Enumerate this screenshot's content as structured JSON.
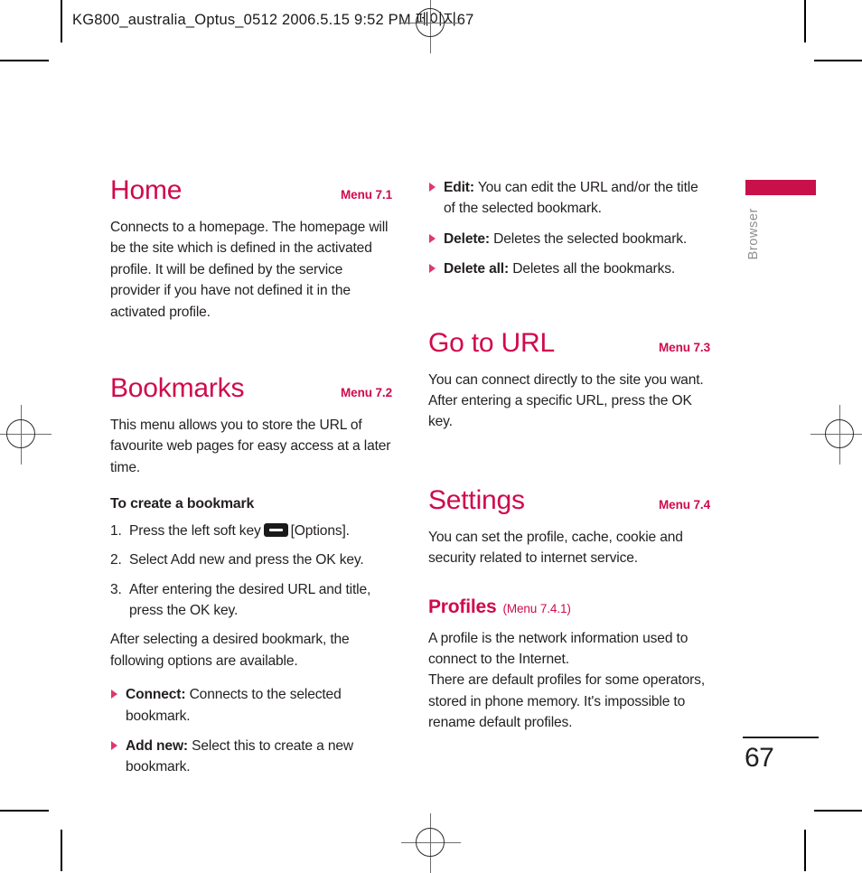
{
  "prepress": {
    "header_text": "KG800_australia_Optus_0512  2006.5.15 9:52 PM  페이지67"
  },
  "thumb_tab": {
    "label": "Browser",
    "bar_color": "#c8104a",
    "label_color": "#8e8e8e"
  },
  "folio": {
    "page_number": "67"
  },
  "theme": {
    "heading_color": "#cf0a4c",
    "bullet_color": "#e0376b",
    "body_color": "#231f20"
  },
  "left_column": {
    "sections": [
      {
        "title": "Home",
        "menu_ref": "Menu 7.1",
        "paragraph": "Connects to a homepage. The homepage will be the site which is defined in the activated profile. It will be defined by the service provider if you have not defined it in the activated profile."
      },
      {
        "title": "Bookmarks",
        "menu_ref": "Menu 7.2",
        "paragraph": "This menu allows you to store the URL of favourite web pages for easy access at a later time.",
        "subhead": "To create a bookmark",
        "steps": [
          {
            "num": "1.",
            "text_before": "Press the left soft key",
            "icon": "soft-key-icon",
            "text_after": "[Options]."
          },
          {
            "num": "2.",
            "text_before": "Select Add new and press the OK key.",
            "icon": null,
            "text_after": ""
          },
          {
            "num": "3.",
            "text_before": "After entering the desired URL and title, press the OK key.",
            "icon": null,
            "text_after": ""
          }
        ],
        "after_steps": "After selecting a desired bookmark, the following options are available.",
        "options": [
          {
            "term": "Connect:",
            "desc": "Connects to the selected bookmark."
          },
          {
            "term": "Add new:",
            "desc": "Select this to create a new bookmark."
          }
        ]
      }
    ]
  },
  "right_column": {
    "continued_options": [
      {
        "term": "Edit:",
        "desc": "You can edit the URL and/or the title of the selected bookmark."
      },
      {
        "term": "Delete:",
        "desc": "Deletes the selected bookmark."
      },
      {
        "term": "Delete all:",
        "desc": "Deletes all the bookmarks."
      }
    ],
    "sections": [
      {
        "title": "Go to URL",
        "menu_ref": "Menu 7.3",
        "paragraph": "You can connect directly to the site you want. After entering a specific URL, press the OK key."
      },
      {
        "title": "Settings",
        "menu_ref": "Menu 7.4",
        "paragraph": "You can set the profile, cache, cookie and security related to internet service.",
        "subsection": {
          "title": "Profiles",
          "menu_ref": "(Menu 7.4.1)",
          "paragraph": "A profile is the network information used to connect to the Internet.\nThere are default profiles for some operators, stored in phone memory. It's impossible to rename default profiles."
        }
      }
    ]
  }
}
